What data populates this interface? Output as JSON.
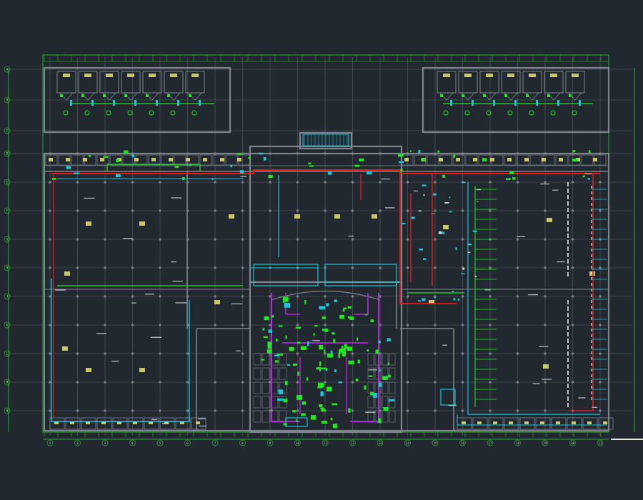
{
  "canvas": {
    "background": "#212830",
    "grid_color": "#5a5f66",
    "wall_color": "#7e848c",
    "dim_line_color": "#21b821"
  },
  "layers": {
    "supply_pipe": "#e01c1c",
    "water_pipe": "#18c8d8",
    "equipment": "#1ee81e",
    "drain_pipe": "#b428e0",
    "annotation": "#c8c864",
    "label_text": "#d0d0d0"
  },
  "axis_labels": {
    "columns": [
      "1",
      "2",
      "3",
      "4",
      "5",
      "6",
      "7",
      "8",
      "9",
      "10",
      "11",
      "12",
      "13",
      "14",
      "15",
      "16",
      "17",
      "18",
      "19",
      "20",
      "21"
    ],
    "rows": [
      "A",
      "B",
      "C",
      "D",
      "E",
      "F",
      "G",
      "H",
      "J",
      "K",
      "L",
      "M",
      "N"
    ]
  }
}
